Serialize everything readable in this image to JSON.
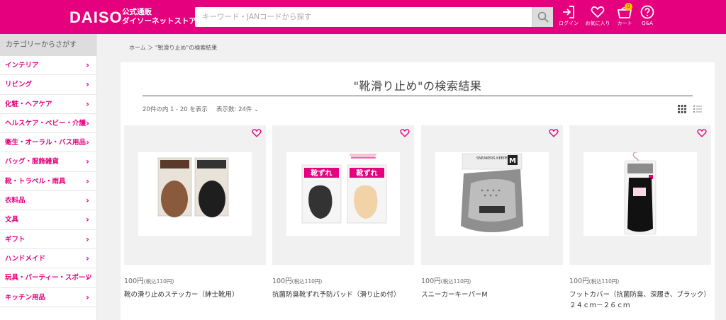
{
  "header": {
    "logo": "DAISO",
    "logo_sub_line1": "公式通販",
    "logo_sub_line2": "ダイソーネットストア",
    "search_placeholder": "キーワード・JANコードから探す",
    "login_label": "ログイン",
    "favorites_label": "お気に入り",
    "cart_label": "カート",
    "cart_count": "0",
    "qa_label": "Q&A"
  },
  "sidebar": {
    "heading": "カテゴリーからさがす",
    "items": [
      {
        "label": "インテリア"
      },
      {
        "label": "リビング"
      },
      {
        "label": "化粧・ヘアケア"
      },
      {
        "label": "ヘルスケア・ベビー・介護"
      },
      {
        "label": "衛生・オーラル・バス用品"
      },
      {
        "label": "バッグ・服飾雑貨"
      },
      {
        "label": "靴・トラベル・雨具"
      },
      {
        "label": "衣料品"
      },
      {
        "label": "文具"
      },
      {
        "label": "ギフト"
      },
      {
        "label": "ハンドメイド"
      },
      {
        "label": "玩具・パーティー・スポーツ"
      },
      {
        "label": "キッチン用品"
      }
    ]
  },
  "breadcrumb": "ホーム ＞ \"靴滑り止め\"の検索結果",
  "main": {
    "title": "\"靴滑り止め\"の検索結果",
    "results_count": "20件の内 1 - 20 を表示",
    "sort_label": "表示数: 24件 ⌄"
  },
  "products": [
    {
      "price": "100円",
      "tax": "(税込110円)",
      "name": "靴の滑り止めステッカー（紳士靴用）"
    },
    {
      "price": "100円",
      "tax": "(税込110円)",
      "name": "抗菌防臭靴ずれ予防パッド（滑り止め付）"
    },
    {
      "price": "100円",
      "tax": "(税込110円)",
      "name": "スニーカーキーパーM"
    },
    {
      "price": "100円",
      "tax": "(税込110円)",
      "name": "フットカバー（抗菌防臭、深履き、ブラック）２４ｃｍ－２６ｃｍ"
    }
  ],
  "package_text": {
    "kutsuzure": "靴ずれ",
    "sneaker_brand": "SNEAKERS KEEPER",
    "size_m": "M"
  },
  "colors": {
    "brand": "#e5007e",
    "panel_bg": "#f1f1f1"
  }
}
